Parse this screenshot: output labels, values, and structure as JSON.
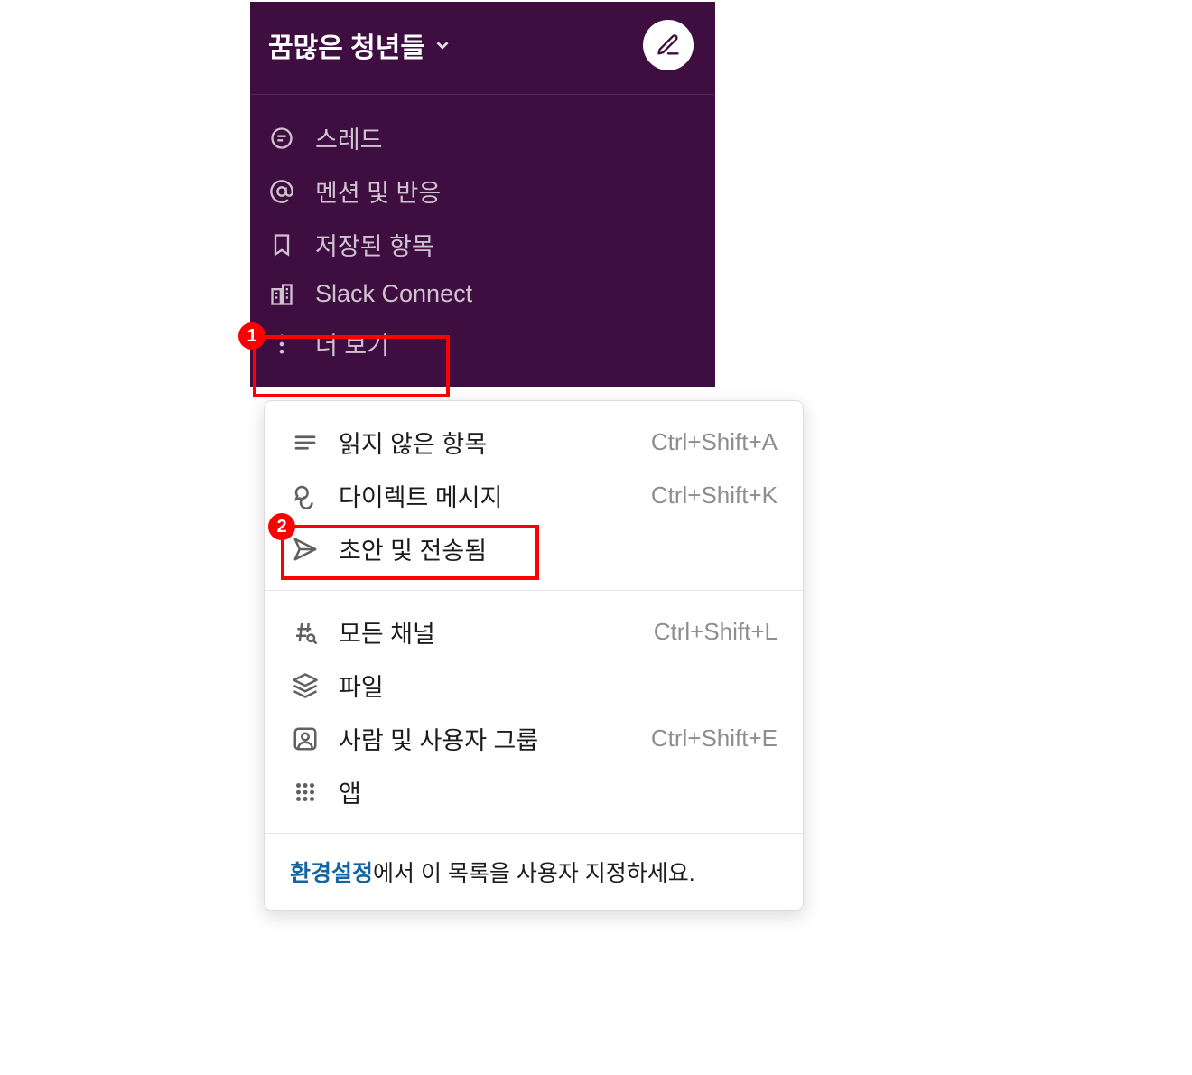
{
  "workspace": {
    "name": "꿈많은 청년들"
  },
  "nav": {
    "threads": "스레드",
    "mentions": "멘션 및 반응",
    "saved": "저장된 항목",
    "slack_connect": "Slack Connect",
    "more": "더 보기"
  },
  "popup": {
    "section1": {
      "unread": {
        "label": "읽지 않은 항목",
        "shortcut": "Ctrl+Shift+A"
      },
      "dm": {
        "label": "다이렉트 메시지",
        "shortcut": "Ctrl+Shift+K"
      },
      "drafts": {
        "label": "초안 및 전송됨",
        "shortcut": ""
      }
    },
    "section2": {
      "all_channels": {
        "label": "모든 채널",
        "shortcut": "Ctrl+Shift+L"
      },
      "files": {
        "label": "파일",
        "shortcut": ""
      },
      "people": {
        "label": "사람 및 사용자 그룹",
        "shortcut": "Ctrl+Shift+E"
      },
      "apps": {
        "label": "앱",
        "shortcut": ""
      }
    },
    "footer": {
      "link": "환경설정",
      "text": "에서 이 목록을 사용자 지정하세요."
    }
  },
  "annotations": {
    "badge1": "1",
    "badge2": "2"
  }
}
